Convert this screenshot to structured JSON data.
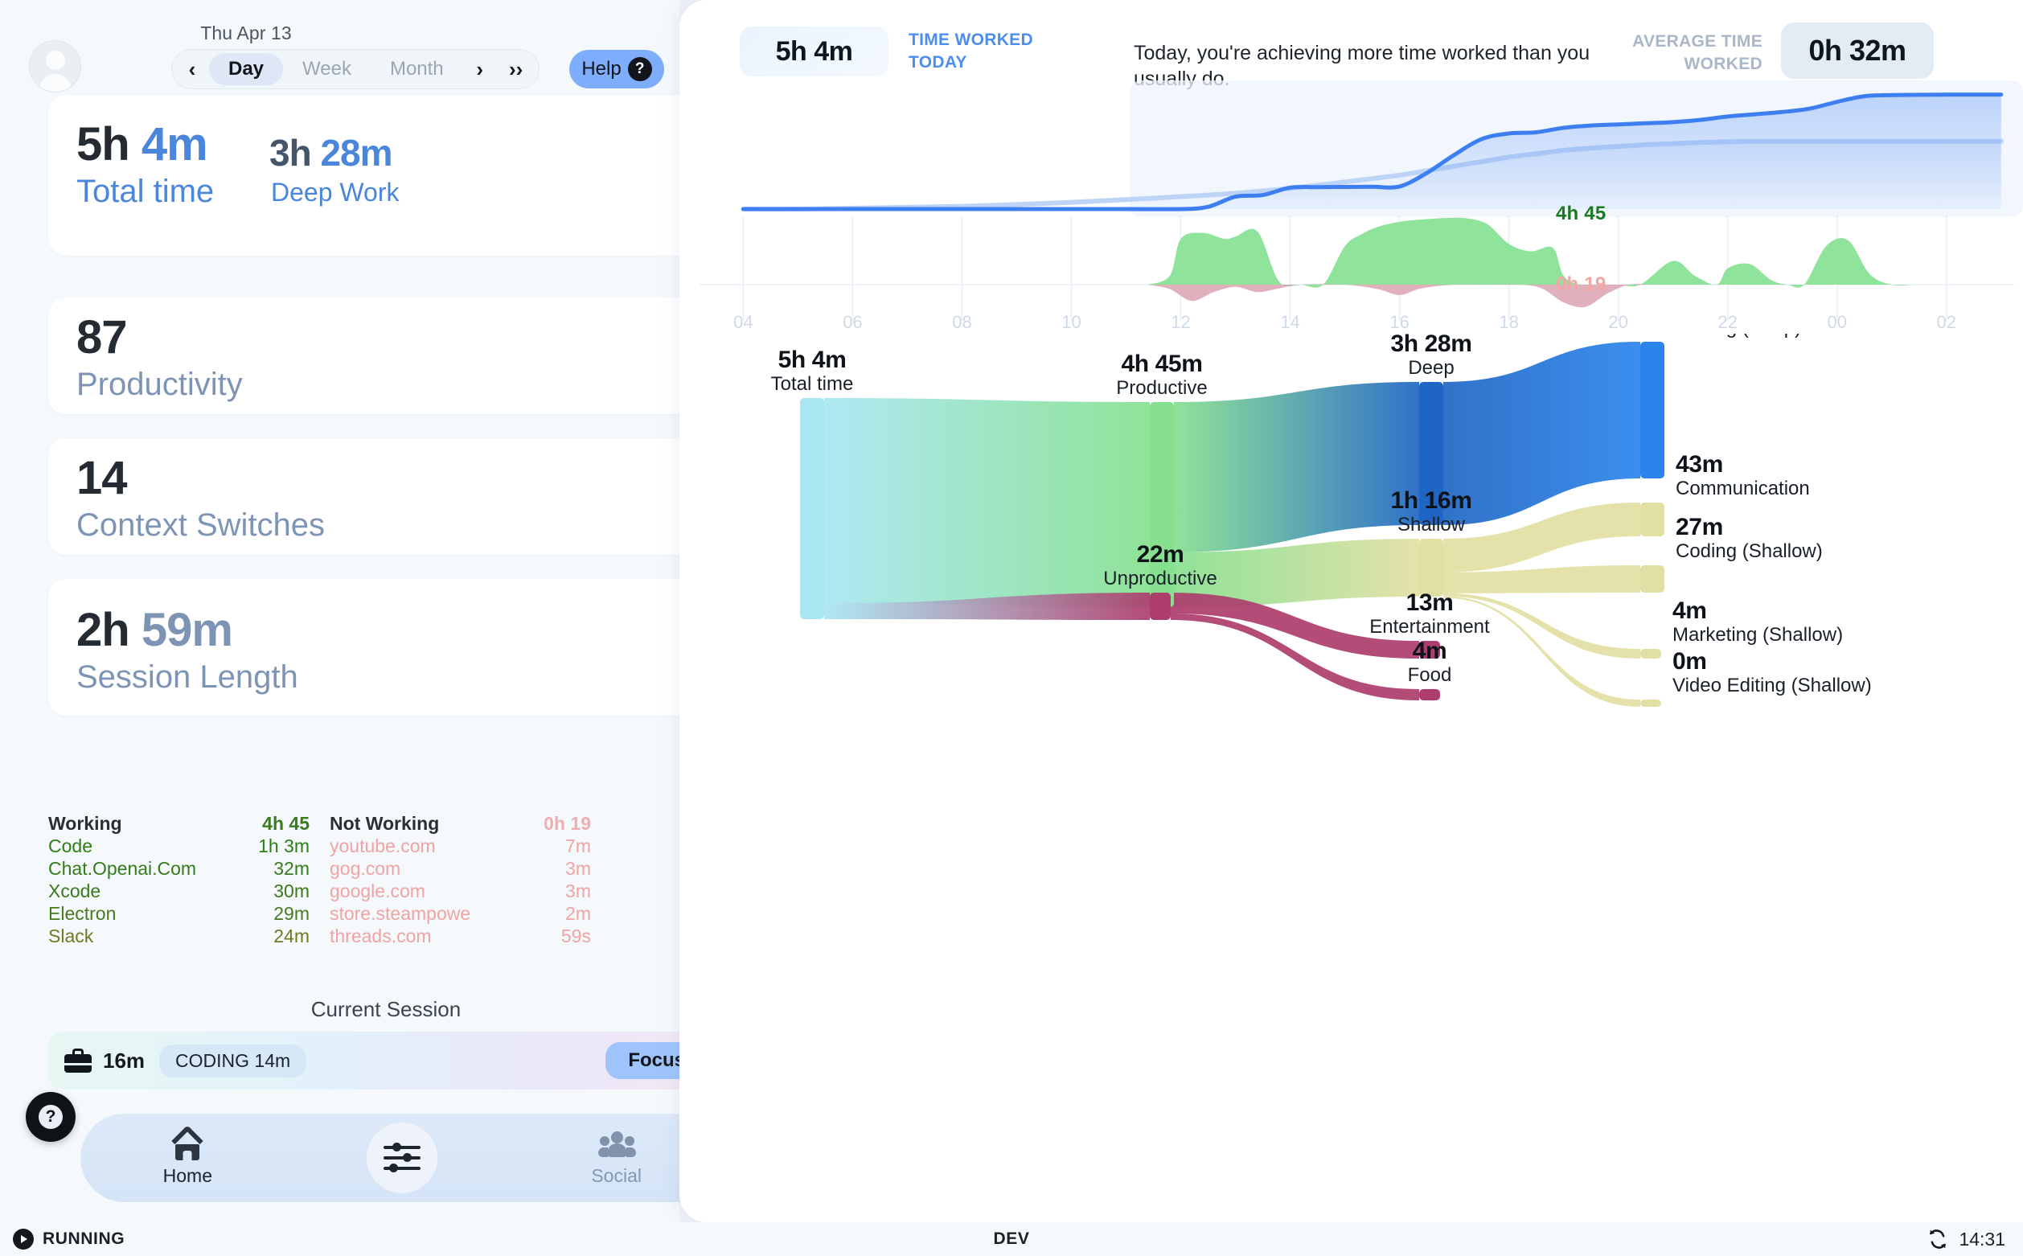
{
  "app": {
    "status_bar": {
      "running_label": "RUNNING",
      "env_label": "DEV",
      "clock": "14:31",
      "play_icon": "play-icon",
      "sync_icon": "sync-icon"
    }
  },
  "sidebar": {
    "avatar": "user-avatar",
    "date_label": "Thu Apr 13",
    "nav": {
      "prev_label": "‹",
      "next_label": "›",
      "fast_forward_label": "››",
      "ranges": [
        {
          "label": "Day",
          "active": true
        },
        {
          "label": "Week",
          "active": false
        },
        {
          "label": "Month",
          "active": false
        }
      ]
    },
    "help_button": {
      "label": "Help",
      "icon": "question-mark-icon"
    },
    "cards": [
      {
        "id": "total-time",
        "value": "5h 4m",
        "label": "Total time",
        "secondary_value": "3h 28m",
        "secondary_label": "Deep Work"
      },
      {
        "id": "productivity",
        "value": "87",
        "label": "Productivity"
      },
      {
        "id": "context-switches",
        "value": "14",
        "label": "Context Switches"
      },
      {
        "id": "session-length",
        "value": "2h 59m",
        "label": "Session Length"
      }
    ],
    "usage": {
      "working": {
        "header": "Working",
        "total": "4h 45",
        "rows": [
          {
            "name": "Code",
            "value": "1h 3m"
          },
          {
            "name": "Chat.Openai.Com",
            "value": "32m"
          },
          {
            "name": "Xcode",
            "value": "30m"
          },
          {
            "name": "Electron",
            "value": "29m"
          },
          {
            "name": "Slack",
            "value": "24m"
          }
        ]
      },
      "not_working": {
        "header": "Not Working",
        "total": "0h 19",
        "rows": [
          {
            "name": "youtube.com",
            "value": "7m"
          },
          {
            "name": "gog.com",
            "value": "3m"
          },
          {
            "name": "google.com",
            "value": "3m"
          },
          {
            "name": "store.steampowe",
            "value": "2m"
          },
          {
            "name": "threads.com",
            "value": "59s"
          }
        ]
      }
    },
    "current_session": {
      "title": "Current Session",
      "icon": "briefcase-icon",
      "elapsed": "16m",
      "tag": "CODING 14m",
      "focus_button": "Focus"
    },
    "help_fab": "help-icon",
    "bottom_nav": [
      {
        "label": "Home",
        "icon": "home-icon",
        "active": true
      },
      {
        "label": "",
        "icon": "sliders-icon",
        "active": false
      },
      {
        "label": "Social",
        "icon": "people-icon",
        "active": false
      }
    ]
  },
  "main": {
    "header": {
      "today_value": "5h 4m",
      "today_caption": "TIME WORKED TODAY",
      "message": "Today, you're achieving more time worked than you usually do.",
      "average_caption": "AVERAGE TIME WORKED",
      "average_value": "0h 32m"
    },
    "timeline": {
      "productive_total": "4h 45",
      "unproductive_total": "0h 19"
    }
  },
  "chart_data": [
    {
      "type": "line",
      "id": "cumulative-time-worked",
      "title": "",
      "xlabel": "",
      "ylabel": "",
      "x": [
        4,
        5,
        6,
        7,
        8,
        9,
        10,
        11,
        12,
        12.5,
        13,
        13.5,
        14,
        14.5,
        15,
        15.5,
        16,
        16.5,
        17,
        17.5,
        18,
        18.5,
        19,
        19.5,
        20,
        20.5,
        21,
        21.5,
        22,
        22.5,
        23,
        23.5,
        24,
        24.5,
        25,
        25.5,
        26,
        26.5,
        27
      ],
      "series": [
        {
          "name": "Today",
          "values": [
            0,
            0,
            0,
            0,
            0,
            0,
            0,
            0,
            0,
            0.1,
            0.55,
            0.62,
            0.95,
            0.97,
            0.98,
            0.99,
            1.0,
            1.6,
            2.4,
            3.1,
            3.35,
            3.4,
            3.6,
            3.7,
            3.75,
            3.8,
            3.85,
            3.95,
            4.1,
            4.2,
            4.3,
            4.45,
            4.75,
            5.0,
            5.05,
            5.06,
            5.07,
            5.07,
            5.07
          ],
          "color": "#3d7ff0"
        },
        {
          "name": "Average",
          "values": [
            0,
            0,
            0.04,
            0.08,
            0.12,
            0.2,
            0.3,
            0.42,
            0.55,
            0.62,
            0.7,
            0.8,
            0.92,
            1.05,
            1.2,
            1.35,
            1.5,
            1.7,
            1.9,
            2.1,
            2.3,
            2.45,
            2.6,
            2.7,
            2.78,
            2.85,
            2.9,
            2.95,
            2.98,
            3.0,
            3.0,
            3.0,
            3.0,
            3.0,
            3.0,
            3.0,
            3.0,
            3.0,
            3.0
          ],
          "color": "#bed4f7"
        }
      ],
      "ylim": [
        0,
        5.2
      ],
      "grid": false,
      "legend": "none"
    },
    {
      "type": "area",
      "id": "hourly-activity",
      "title": "",
      "xlabel": "",
      "ylabel": "",
      "xticks": [
        "04",
        "06",
        "08",
        "10",
        "12",
        "14",
        "16",
        "18",
        "20",
        "22",
        "00",
        "02"
      ],
      "annotations": [
        {
          "text": "4h 45",
          "color": "#1a7a20",
          "position": "top"
        },
        {
          "text": "0h 19",
          "color": "#f2a6a6",
          "position": "bottom"
        }
      ],
      "series": [
        {
          "name": "Productive",
          "color": "#8fe39a",
          "x": [
            11.4,
            11.8,
            12.0,
            12.4,
            12.8,
            13.0,
            13.4,
            13.8,
            14.2,
            14.6,
            15.0,
            15.3,
            15.6,
            16.0,
            16.4,
            16.8,
            17.2,
            17.6,
            18.0,
            18.4,
            18.8,
            19.0,
            19.3,
            19.6,
            20.0,
            20.4,
            21.0,
            21.4,
            21.8,
            22.0,
            22.4,
            22.8,
            23.1,
            23.4,
            23.8,
            24.2,
            24.6,
            25.0,
            25.4
          ],
          "values": [
            0,
            0.12,
            0.62,
            0.7,
            0.62,
            0.65,
            0.72,
            0.04,
            0,
            0,
            0.52,
            0.68,
            0.78,
            0.85,
            0.88,
            0.9,
            0.9,
            0.82,
            0.55,
            0.45,
            0.5,
            0.12,
            0,
            0,
            0,
            0,
            0.32,
            0.12,
            0,
            0.22,
            0.28,
            0.06,
            0,
            0,
            0.52,
            0.6,
            0.14,
            0,
            0
          ]
        },
        {
          "name": "Unproductive",
          "color": "#dba2b0",
          "x": [
            11.4,
            11.8,
            12.2,
            12.6,
            13.0,
            13.4,
            13.8,
            14.2,
            15.0,
            15.6,
            16.0,
            16.4,
            17.0,
            17.6,
            18.2,
            18.6,
            19.0,
            19.4,
            19.8,
            20.2,
            20.6
          ],
          "values": [
            0,
            -0.06,
            -0.22,
            -0.1,
            -0.03,
            -0.1,
            -0.05,
            0,
            0,
            -0.06,
            -0.14,
            -0.05,
            0,
            0,
            0,
            -0.05,
            -0.24,
            -0.3,
            -0.12,
            0,
            0
          ]
        }
      ],
      "ylim": [
        -0.4,
        1.0
      ],
      "grid": true,
      "legend": "none"
    },
    {
      "type": "sankey",
      "id": "time-breakdown-sankey",
      "title": "",
      "nodes": [
        {
          "id": "total",
          "value_label": "5h  4m",
          "name_label": "Total time",
          "column": 0,
          "color": "#a8e7f2"
        },
        {
          "id": "productive",
          "value_label": "4h  45m",
          "name_label": "Productive",
          "column": 1,
          "color": "#86e08f"
        },
        {
          "id": "unproductive",
          "value_label": "22m",
          "name_label": "Unproductive",
          "column": 1,
          "color": "#ad3d6c"
        },
        {
          "id": "deep",
          "value_label": "3h  28m",
          "name_label": "Deep",
          "column": 2,
          "color": "#1f66c4"
        },
        {
          "id": "shallow",
          "value_label": "1h  16m",
          "name_label": "Shallow",
          "column": 2,
          "color": "#e2dfa2"
        },
        {
          "id": "entertainment",
          "value_label": "13m",
          "name_label": "Entertainment",
          "column": 2,
          "color": "#ad3d6c"
        },
        {
          "id": "food",
          "value_label": "4m",
          "name_label": "Food",
          "column": 2,
          "color": "#ad3d6c"
        },
        {
          "id": "coding_deep",
          "value_label": "3h  28m",
          "name_label": "Coding (Deep)",
          "column": 3,
          "color": "#2a84ec"
        },
        {
          "id": "communication",
          "value_label": "43m",
          "name_label": "Communication",
          "column": 3,
          "color": "#e2dfa2"
        },
        {
          "id": "coding_shal",
          "value_label": "27m",
          "name_label": "Coding (Shallow)",
          "column": 3,
          "color": "#e2dfa2"
        },
        {
          "id": "marketing",
          "value_label": "4m",
          "name_label": "Marketing (Shallow)",
          "column": 3,
          "color": "#e2dfa2"
        },
        {
          "id": "video_edit",
          "value_label": "0m",
          "name_label": "Video Editing (Shallow)",
          "column": 3,
          "color": "#e2dfa2"
        }
      ],
      "links": [
        {
          "source": "total",
          "target": "productive",
          "value": 285
        },
        {
          "source": "total",
          "target": "unproductive",
          "value": 22
        },
        {
          "source": "productive",
          "target": "deep",
          "value": 208
        },
        {
          "source": "productive",
          "target": "shallow",
          "value": 76
        },
        {
          "source": "unproductive",
          "target": "entertainment",
          "value": 13
        },
        {
          "source": "unproductive",
          "target": "food",
          "value": 4
        },
        {
          "source": "deep",
          "target": "coding_deep",
          "value": 208
        },
        {
          "source": "shallow",
          "target": "communication",
          "value": 43
        },
        {
          "source": "shallow",
          "target": "coding_shal",
          "value": 27
        },
        {
          "source": "shallow",
          "target": "marketing",
          "value": 4
        },
        {
          "source": "shallow",
          "target": "video_edit",
          "value": 0.4
        }
      ]
    }
  ]
}
